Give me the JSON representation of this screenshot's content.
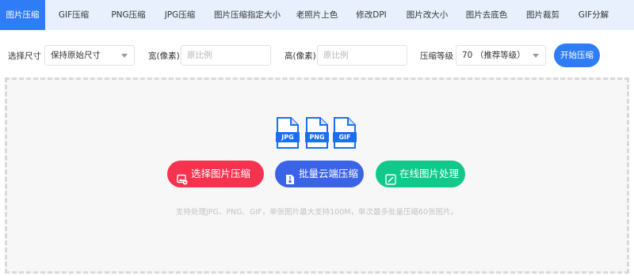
{
  "tabs": [
    {
      "label": "图片压缩",
      "active": true
    },
    {
      "label": "GIF压缩",
      "active": false
    },
    {
      "label": "PNG压缩",
      "active": false
    },
    {
      "label": "JPG压缩",
      "active": false
    },
    {
      "label": "图片压缩指定大小",
      "active": false
    },
    {
      "label": "老照片上色",
      "active": false
    },
    {
      "label": "修改DPI",
      "active": false
    },
    {
      "label": "图片改大小",
      "active": false
    },
    {
      "label": "图片去底色",
      "active": false
    },
    {
      "label": "图片裁剪",
      "active": false
    },
    {
      "label": "GIF分解",
      "active": false
    }
  ],
  "options": {
    "size_label": "选择尺寸",
    "size_value": "保持原始尺寸",
    "width_label": "宽(像素)",
    "width_placeholder": "原比例",
    "height_label": "高(像素)",
    "height_placeholder": "原比例",
    "level_label": "压缩等级",
    "level_value": "70 （推荐等级）",
    "start_label": "开始压缩"
  },
  "upload": {
    "file_types": [
      "JPG",
      "PNG",
      "GIF"
    ],
    "select_label": "选择图片压缩",
    "cloud_label": "批量云端压缩",
    "online_label": "在线图片处理",
    "hint": "支持处理JPG、PNG、GIF，单张图片最大支持100M，单次最多批量压缩60张图片。"
  },
  "colors": {
    "accent": "#2f7cf6",
    "tab_bar": "#e8f0fd",
    "select_button": "#f5334f",
    "cloud_button": "#3a63e8",
    "online_button": "#10c98b",
    "file_icon": "#1a6ff0"
  }
}
